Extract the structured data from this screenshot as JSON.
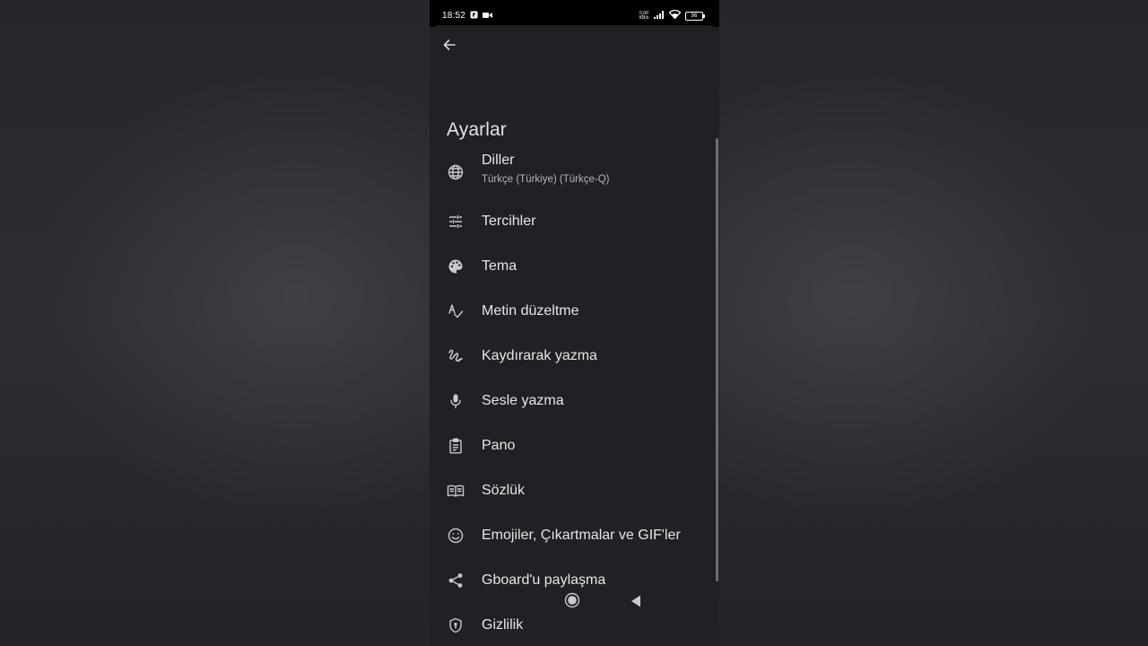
{
  "status_bar": {
    "time": "18:52",
    "net_speed_value": "0,00",
    "net_speed_unit": "KB/s",
    "battery": "96",
    "left_icons": [
      "notification-icon",
      "video-record-icon"
    ],
    "right_icons": [
      "signal-icon",
      "wifi-icon",
      "battery-icon"
    ]
  },
  "header": {
    "back_icon": "arrow-back-icon",
    "title": "Ayarlar"
  },
  "menu": {
    "items": [
      {
        "icon": "globe-icon",
        "label": "Diller",
        "sublabel": "Türkçe (Türkiye) (Türkçe-Q)"
      },
      {
        "icon": "tune-icon",
        "label": "Tercihler"
      },
      {
        "icon": "palette-icon",
        "label": "Tema"
      },
      {
        "icon": "spellcheck-icon",
        "label": "Metin düzeltme"
      },
      {
        "icon": "gesture-icon",
        "label": "Kaydırarak yazma"
      },
      {
        "icon": "microphone-icon",
        "label": "Sesle yazma"
      },
      {
        "icon": "clipboard-icon",
        "label": "Pano"
      },
      {
        "icon": "dictionary-icon",
        "label": "Sözlük"
      },
      {
        "icon": "emoji-icon",
        "label": "Emojiler, Çıkartmalar ve GIF'ler"
      },
      {
        "icon": "share-icon",
        "label": "Gboard'u paylaşma"
      },
      {
        "icon": "shield-icon",
        "label": "Gizlilik"
      }
    ]
  },
  "nav_bar": {
    "icons": [
      "home-circle-icon",
      "back-triangle-icon"
    ]
  },
  "colors": {
    "sheet_background": "#1f2124",
    "text_primary": "#e6e6e8",
    "text_secondary": "#b4b5b9",
    "status_bar": "#000000"
  }
}
